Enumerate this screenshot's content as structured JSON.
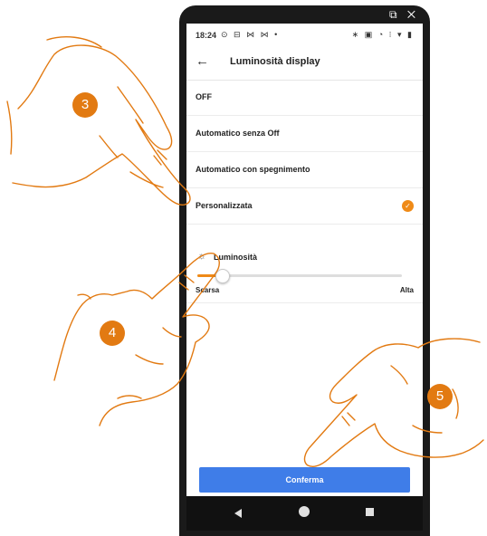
{
  "window": {
    "tool_icons": "⧉ ✕"
  },
  "status_bar": {
    "time": "18:24",
    "left_icons": "⊙ ⊟ ⋈ ⋈ •",
    "right_icons": "∗ ▣ ◔ ⁝ ▾ ▮"
  },
  "header": {
    "back_icon": "←",
    "title": "Luminosità display"
  },
  "options": [
    {
      "label": "OFF",
      "selected": false
    },
    {
      "label": "Automatico senza Off",
      "selected": false
    },
    {
      "label": "Automatico con spegnimento",
      "selected": false
    },
    {
      "label": "Personalizzata",
      "selected": true
    }
  ],
  "brightness": {
    "icon": "sun-icon",
    "label": "Luminosità",
    "value_fraction": 0.12,
    "low_label": "Scarsa",
    "high_label": "Alta"
  },
  "confirm_button": {
    "label": "Conferma"
  },
  "steps": {
    "three": "3",
    "four": "4",
    "five": "5"
  },
  "colors": {
    "accent": "#ef8a17",
    "button": "#3f7de8",
    "step_badge": "#e27a12"
  }
}
